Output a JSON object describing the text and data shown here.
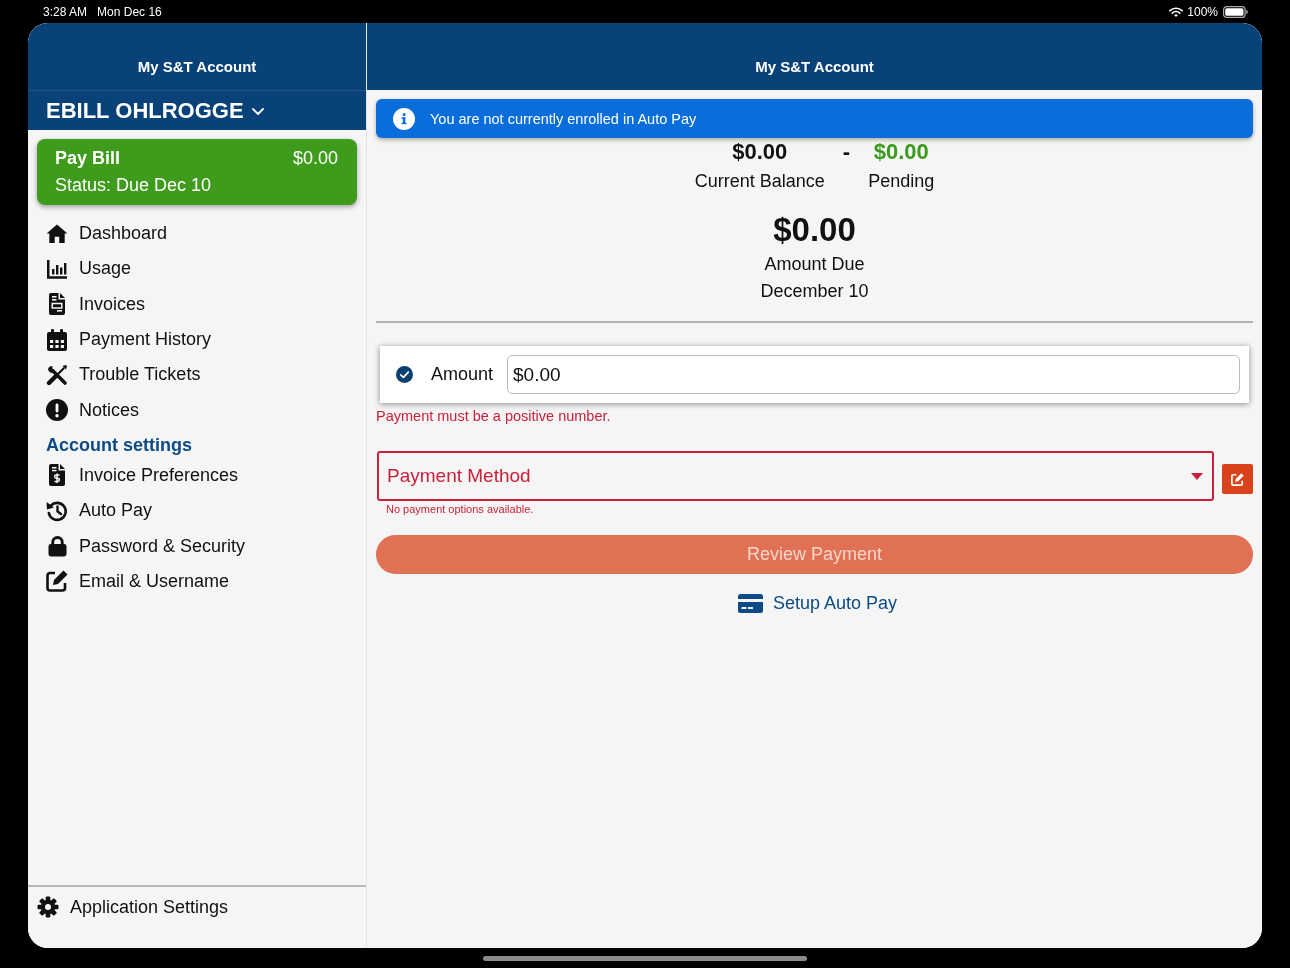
{
  "status_bar": {
    "time": "3:28 AM",
    "date": "Mon Dec 16",
    "battery": "100%"
  },
  "sidebar": {
    "title": "My S&T Account",
    "account": "EBILL OHLROGGE",
    "pay_bill": {
      "title": "Pay Bill",
      "amount": "$0.00",
      "status": "Status: Due Dec 10"
    },
    "nav_items": [
      "Dashboard",
      "Usage",
      "Invoices",
      "Payment History",
      "Trouble Tickets",
      "Notices"
    ],
    "section_title": "Account settings",
    "settings_items": [
      "Invoice Preferences",
      "Auto Pay",
      "Password & Security",
      "Email & Username"
    ],
    "footer_item": "Application Settings"
  },
  "main": {
    "title": "My S&T Account",
    "banner": "You are not currently enrolled in Auto Pay",
    "current_balance": {
      "value": "$0.00",
      "label": "Current Balance"
    },
    "separator": "-",
    "pending": {
      "value": "$0.00",
      "label": "Pending"
    },
    "amount_due": {
      "value": "$0.00",
      "label": "Amount Due",
      "date": "December 10"
    },
    "amount_field": {
      "checked": true,
      "label": "Amount",
      "value": "$0.00"
    },
    "amount_error": "Payment must be a positive number.",
    "payment_method": {
      "placeholder": "Payment Method",
      "error": "No payment options available."
    },
    "review_button": {
      "label": "Review Payment",
      "disabled": true
    },
    "setup_link": "Setup Auto Pay"
  }
}
